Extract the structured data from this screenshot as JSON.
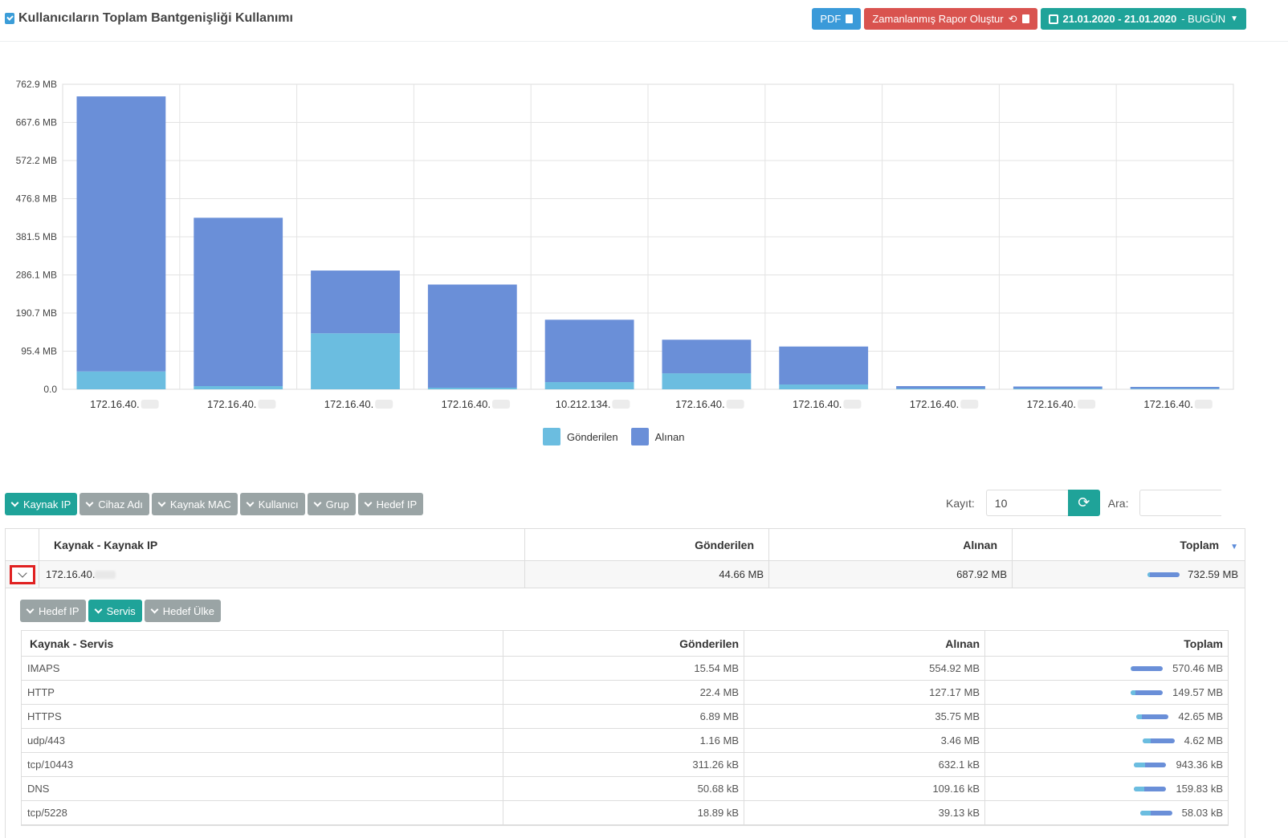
{
  "header": {
    "title": "Kullanıcıların Toplam Bantgenişliği Kullanımı",
    "pdf_label": "PDF",
    "schedule_label": "Zamanlanmış Rapor Oluştur",
    "date_range": "21.01.2020 - 21.01.2020",
    "date_suffix": "- BUGÜN"
  },
  "colors": {
    "sent": "#6bbde0",
    "received": "#6a8fd8",
    "accent": "#1fa399",
    "danger": "#d9534f",
    "primary": "#3a9ad9"
  },
  "chart_data": {
    "type": "bar",
    "stacked": true,
    "categories": [
      "172.16.40.",
      "172.16.40.",
      "172.16.40.",
      "172.16.40.",
      "10.212.134.",
      "172.16.40.",
      "172.16.40.",
      "172.16.40.",
      "172.16.40.",
      "172.16.40."
    ],
    "series": [
      {
        "name": "Gönderilen",
        "values": [
          44.66,
          8,
          140,
          4,
          18,
          40,
          12,
          2,
          2,
          1.5
        ]
      },
      {
        "name": "Alınan",
        "values": [
          687.92,
          421,
          157,
          258,
          156,
          84,
          95,
          6,
          5,
          4.5
        ]
      }
    ],
    "yticks": [
      "0.0",
      "95.4 MB",
      "190.7 MB",
      "286.1 MB",
      "381.5 MB",
      "476.8 MB",
      "572.2 MB",
      "667.6 MB",
      "762.9 MB"
    ],
    "ylim": [
      0,
      762.9
    ],
    "grid": true,
    "legend": "bottom"
  },
  "toolbar": {
    "groups": [
      {
        "label": "Kaynak IP",
        "active": true
      },
      {
        "label": "Cihaz Adı",
        "active": false
      },
      {
        "label": "Kaynak MAC",
        "active": false
      },
      {
        "label": "Kullanıcı",
        "active": false
      },
      {
        "label": "Grup",
        "active": false
      },
      {
        "label": "Hedef IP",
        "active": false
      }
    ],
    "records_label": "Kayıt:",
    "records_value": "10",
    "search_label": "Ara:"
  },
  "main_table": {
    "headers": [
      "Kaynak - Kaynak IP",
      "Gönderilen",
      "Alınan",
      "Toplam"
    ],
    "row": {
      "ip": "172.16.40.",
      "sent": "44.66 MB",
      "received": "687.92 MB",
      "total": "732.59 MB",
      "sent_ratio": 0.06
    }
  },
  "sub": {
    "groups": [
      {
        "label": "Hedef IP",
        "active": false
      },
      {
        "label": "Servis",
        "active": true
      },
      {
        "label": "Hedef Ülke",
        "active": false
      }
    ],
    "headers": [
      "Kaynak - Servis",
      "Gönderilen",
      "Alınan",
      "Toplam"
    ],
    "rows": [
      {
        "service": "IMAPS",
        "sent": "15.54 MB",
        "received": "554.92 MB",
        "total": "570.46 MB",
        "sent_ratio": 0.03
      },
      {
        "service": "HTTP",
        "sent": "22.4 MB",
        "received": "127.17 MB",
        "total": "149.57 MB",
        "sent_ratio": 0.15
      },
      {
        "service": "HTTPS",
        "sent": "6.89 MB",
        "received": "35.75 MB",
        "total": "42.65 MB",
        "sent_ratio": 0.16
      },
      {
        "service": "udp/443",
        "sent": "1.16 MB",
        "received": "3.46 MB",
        "total": "4.62 MB",
        "sent_ratio": 0.25
      },
      {
        "service": "tcp/10443",
        "sent": "311.26 kB",
        "received": "632.1 kB",
        "total": "943.36 kB",
        "sent_ratio": 0.33
      },
      {
        "service": "DNS",
        "sent": "50.68 kB",
        "received": "109.16 kB",
        "total": "159.83 kB",
        "sent_ratio": 0.32
      },
      {
        "service": "tcp/5228",
        "sent": "18.89 kB",
        "received": "39.13 kB",
        "total": "58.03 kB",
        "sent_ratio": 0.33
      }
    ]
  }
}
